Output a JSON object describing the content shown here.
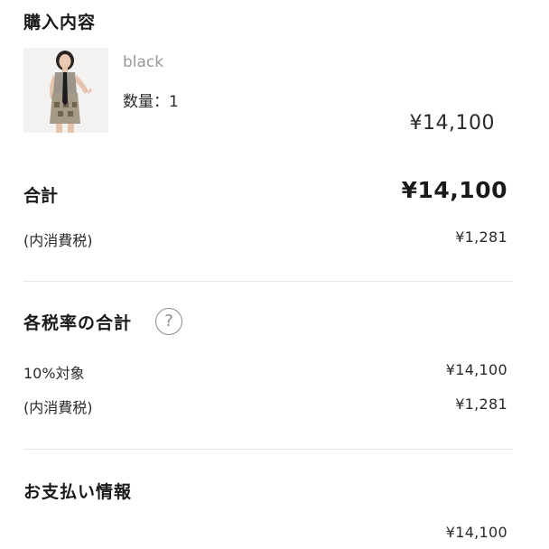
{
  "purchase": {
    "title": "購入内容",
    "item": {
      "variant": "black",
      "quantity": "数量：1",
      "price": "¥14,100"
    }
  },
  "total": {
    "label": "合計",
    "value": "¥14,100",
    "tax_label": "(内消費税)",
    "tax_value": "¥1,281"
  },
  "tax_rates": {
    "title": "各税率の合計",
    "help_icon": "question-circle-icon",
    "rows": [
      {
        "label": "10%対象",
        "value": "¥14,100"
      },
      {
        "label": "(内消費税)",
        "value": "¥1,281"
      }
    ]
  },
  "payment": {
    "title": "お支払い情報",
    "amount": "¥14,100"
  }
}
